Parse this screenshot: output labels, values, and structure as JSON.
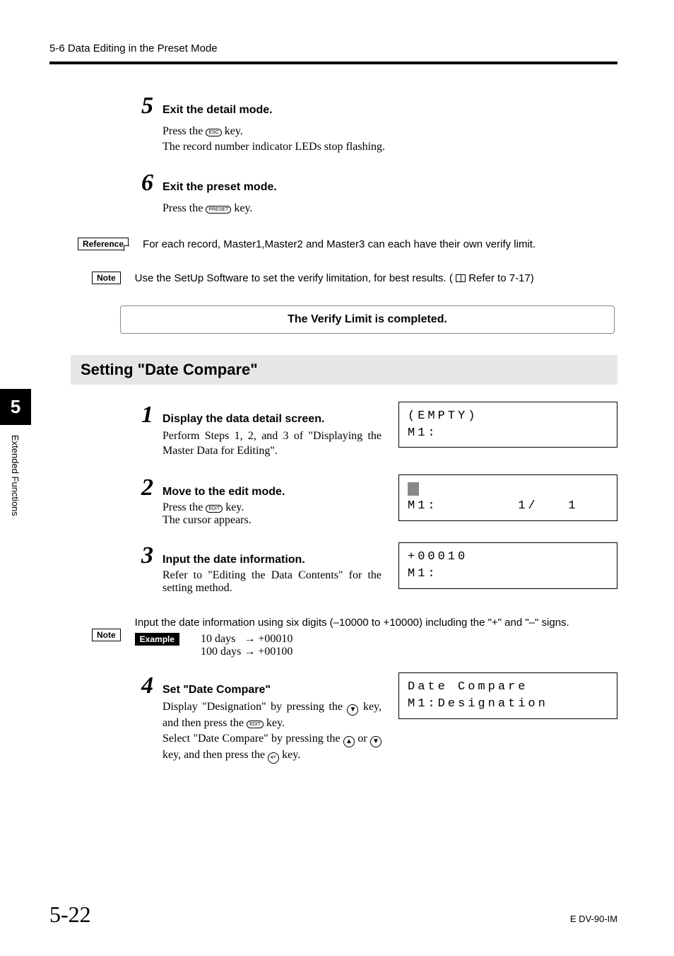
{
  "header": "5-6  Data Editing in the Preset Mode",
  "side_tab": {
    "num": "5",
    "label": "Extended Functions"
  },
  "step5": {
    "num": "5",
    "title": "Exit the detail mode.",
    "line1a": "Press the ",
    "key1": "ESC",
    "line1b": " key.",
    "line2": "The record number indicator LEDs stop flashing."
  },
  "step6": {
    "num": "6",
    "title": "Exit the preset mode.",
    "line1a": "Press the ",
    "key1": "PRESET",
    "line1b": " key."
  },
  "reference": {
    "label": "Reference",
    "text": "For each record, Master1,Master2 and Master3 can each have their own verify limit."
  },
  "note1": {
    "label": "Note",
    "text_a": "Use the SetUp Software to set the verify limitation, for best results. ( ",
    "text_b": " Refer to 7-17)"
  },
  "banner": "The Verify Limit is completed.",
  "section_title": "Setting \"Date Compare\"",
  "step1": {
    "num": "1",
    "title": "Display the data detail screen.",
    "body": "Perform Steps 1, 2, and 3 of \"Displaying the Master Data for Editing\".",
    "lcd_l1": "(EMPTY)",
    "lcd_l2": "M1:"
  },
  "step2": {
    "num": "2",
    "title": "Move to the edit mode.",
    "body_a": "Press the ",
    "key": "EDIT",
    "body_b": " key.",
    "body2": "The cursor appears.",
    "lcd_cursor": "0",
    "lcd_l2": "M1:        1/   1"
  },
  "step3": {
    "num": "3",
    "title": "Input the date information.",
    "body": "Refer to \"Editing the Data Contents\" for the setting method.",
    "lcd_l1": "+00010",
    "lcd_l2": "M1:"
  },
  "note2": {
    "label": "Note",
    "text": "Input the date information using six digits (–10000 to +10000) including the \"+\" and \"–\" signs.",
    "ex_label": "Example",
    "ex1_a": "10 days",
    "ex1_b": "+00010",
    "ex2_a": "100 days",
    "ex2_b": "+00100"
  },
  "step4": {
    "num": "4",
    "title": "Set \"Date Compare\"",
    "line1a": "Display \"Designation\" by pressing the ",
    "line1b": " key, and then press the ",
    "key_edit": "EDIT",
    "line1c": " key.",
    "line2a": "Select \"Date Compare\" by pressing the ",
    "line2b": " or ",
    "line2c": " key, and then press the ",
    "line2d": " key.",
    "lcd_l1": "Date Compare",
    "lcd_l2": "M1:Designation"
  },
  "footer": {
    "page": "5-22",
    "code": "E DV-90-IM"
  }
}
